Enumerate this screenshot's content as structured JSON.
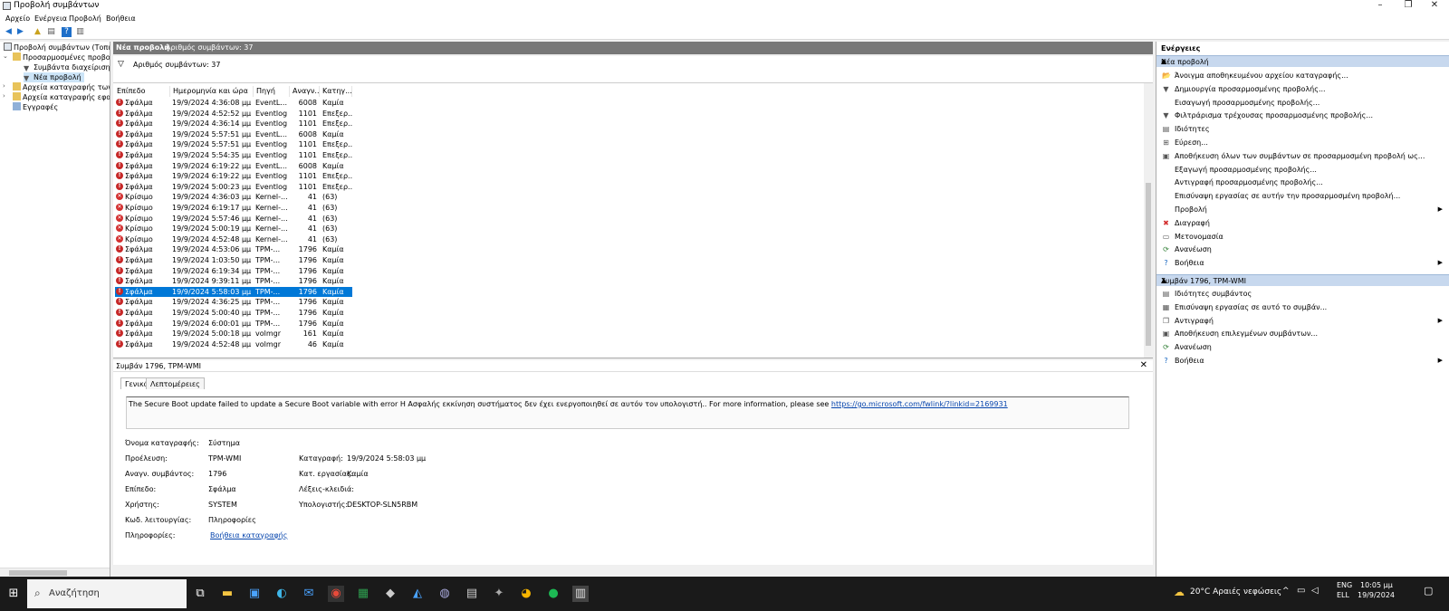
{
  "window": {
    "title": "Προβολή συμβάντων"
  },
  "menu": [
    "Αρχείο",
    "Ενέργεια",
    "Προβολή",
    "Βοήθεια"
  ],
  "tree": {
    "items": [
      {
        "label": "Προβολή συμβάντων (Τοπική)"
      },
      {
        "label": "Προσαρμοσμένες προβολές"
      },
      {
        "label": "Συμβάντα διαχείρισης"
      },
      {
        "label": "Νέα προβολή"
      },
      {
        "label": "Αρχεία καταγραφής των Windows"
      },
      {
        "label": "Αρχεία καταγραφής εφαρμογών"
      },
      {
        "label": "Εγγραφές"
      }
    ]
  },
  "middle": {
    "header_title": "Νέα προβολή",
    "header_count": "Αριθμός συμβάντων: 37",
    "filter_text": "Αριθμός συμβάντων: 37"
  },
  "columns": [
    "Επίπεδο",
    "Ημερομηνία και ώρα",
    "Πηγή",
    "Αναγν...",
    "Κατηγ..."
  ],
  "events": [
    {
      "level": "Σφάλμα",
      "date": "19/9/2024 4:36:08 μμ",
      "source": "EventL...",
      "id": "6008",
      "cat": "Καμία",
      "crit": false
    },
    {
      "level": "Σφάλμα",
      "date": "19/9/2024 4:52:52 μμ",
      "source": "Eventlog",
      "id": "1101",
      "cat": "Επεξερ...",
      "crit": false
    },
    {
      "level": "Σφάλμα",
      "date": "19/9/2024 4:36:14 μμ",
      "source": "Eventlog",
      "id": "1101",
      "cat": "Επεξερ...",
      "crit": false
    },
    {
      "level": "Σφάλμα",
      "date": "19/9/2024 5:57:51 μμ",
      "source": "EventL...",
      "id": "6008",
      "cat": "Καμία",
      "crit": false
    },
    {
      "level": "Σφάλμα",
      "date": "19/9/2024 5:57:51 μμ",
      "source": "Eventlog",
      "id": "1101",
      "cat": "Επεξερ...",
      "crit": false
    },
    {
      "level": "Σφάλμα",
      "date": "19/9/2024 5:54:35 μμ",
      "source": "Eventlog",
      "id": "1101",
      "cat": "Επεξερ...",
      "crit": false
    },
    {
      "level": "Σφάλμα",
      "date": "19/9/2024 6:19:22 μμ",
      "source": "EventL...",
      "id": "6008",
      "cat": "Καμία",
      "crit": false
    },
    {
      "level": "Σφάλμα",
      "date": "19/9/2024 6:19:22 μμ",
      "source": "Eventlog",
      "id": "1101",
      "cat": "Επεξερ...",
      "crit": false
    },
    {
      "level": "Σφάλμα",
      "date": "19/9/2024 5:00:23 μμ",
      "source": "Eventlog",
      "id": "1101",
      "cat": "Επεξερ...",
      "crit": false
    },
    {
      "level": "Κρίσιμο",
      "date": "19/9/2024 4:36:03 μμ",
      "source": "Kernel-...",
      "id": "41",
      "cat": "(63)",
      "crit": true
    },
    {
      "level": "Κρίσιμο",
      "date": "19/9/2024 6:19:17 μμ",
      "source": "Kernel-...",
      "id": "41",
      "cat": "(63)",
      "crit": true
    },
    {
      "level": "Κρίσιμο",
      "date": "19/9/2024 5:57:46 μμ",
      "source": "Kernel-...",
      "id": "41",
      "cat": "(63)",
      "crit": true
    },
    {
      "level": "Κρίσιμο",
      "date": "19/9/2024 5:00:19 μμ",
      "source": "Kernel-...",
      "id": "41",
      "cat": "(63)",
      "crit": true
    },
    {
      "level": "Κρίσιμο",
      "date": "19/9/2024 4:52:48 μμ",
      "source": "Kernel-...",
      "id": "41",
      "cat": "(63)",
      "crit": true
    },
    {
      "level": "Σφάλμα",
      "date": "19/9/2024 4:53:06 μμ",
      "source": "TPM-...",
      "id": "1796",
      "cat": "Καμία",
      "crit": false
    },
    {
      "level": "Σφάλμα",
      "date": "19/9/2024 1:03:50 μμ",
      "source": "TPM-...",
      "id": "1796",
      "cat": "Καμία",
      "crit": false
    },
    {
      "level": "Σφάλμα",
      "date": "19/9/2024 6:19:34 μμ",
      "source": "TPM-...",
      "id": "1796",
      "cat": "Καμία",
      "crit": false
    },
    {
      "level": "Σφάλμα",
      "date": "19/9/2024 9:39:11 μμ",
      "source": "TPM-...",
      "id": "1796",
      "cat": "Καμία",
      "crit": false
    },
    {
      "level": "Σφάλμα",
      "date": "19/9/2024 5:58:03 μμ",
      "source": "TPM-...",
      "id": "1796",
      "cat": "Καμία",
      "crit": false,
      "selected": true
    },
    {
      "level": "Σφάλμα",
      "date": "19/9/2024 4:36:25 μμ",
      "source": "TPM-...",
      "id": "1796",
      "cat": "Καμία",
      "crit": false
    },
    {
      "level": "Σφάλμα",
      "date": "19/9/2024 5:00:40 μμ",
      "source": "TPM-...",
      "id": "1796",
      "cat": "Καμία",
      "crit": false
    },
    {
      "level": "Σφάλμα",
      "date": "19/9/2024 6:00:01 μμ",
      "source": "TPM-...",
      "id": "1796",
      "cat": "Καμία",
      "crit": false
    },
    {
      "level": "Σφάλμα",
      "date": "19/9/2024 5:00:18 μμ",
      "source": "volmgr",
      "id": "161",
      "cat": "Καμία",
      "crit": false
    },
    {
      "level": "Σφάλμα",
      "date": "19/9/2024 4:52:48 μμ",
      "source": "volmgr",
      "id": "46",
      "cat": "Καμία",
      "crit": false
    }
  ],
  "detail": {
    "title": "Συμβάν 1796, TPM-WMI",
    "tabs": [
      "Γενικά",
      "Λεπτομέρειες"
    ],
    "description": "The Secure Boot update failed to update a Secure Boot variable with error Η Ασφαλής εκκίνηση συστήματος δεν έχει ενεργοποιηθεί σε αυτόν τον υπολογιστή.. For more information, please see ",
    "description_link": "https://go.microsoft.com/fwlink/?linkid=2169931",
    "props": {
      "log_name_label": "Όνομα καταγραφής:",
      "log_name": "Σύστημα",
      "source_label": "Προέλευση:",
      "source": "TPM-WMI",
      "logged_label": "Καταγραφή:",
      "logged": "19/9/2024 5:58:03 μμ",
      "event_id_label": "Αναγν. συμβάντος:",
      "event_id": "1796",
      "task_label": "Κατ. εργασίας:",
      "task": "Καμία",
      "level_label": "Επίπεδο:",
      "level": "Σφάλμα",
      "keywords_label": "Λέξεις-κλειδιά:",
      "user_label": "Χρήστης:",
      "user": "SYSTEM",
      "computer_label": "Υπολογιστής:",
      "computer": "DESKTOP-SLN5RBM",
      "opcode_label": "Κωδ. λειτουργίας:",
      "opcode": "Πληροφορίες",
      "info_label": "Πληροφορίες:",
      "info_link": "Βοήθεια καταγραφής"
    }
  },
  "actions": {
    "title": "Ενέργειες",
    "section1": "Νέα προβολή",
    "items1": [
      {
        "label": "Άνοιγμα αποθηκευμένου αρχείου καταγραφής...",
        "icon": "folder-icon",
        "glyph": "📂"
      },
      {
        "label": "Δημιουργία προσαρμοσμένης προβολής...",
        "icon": "filter-icon",
        "glyph": "▼"
      },
      {
        "label": "Εισαγωγή προσαρμοσμένης προβολής...",
        "icon": "",
        "glyph": ""
      },
      {
        "label": "Φιλτράρισμα τρέχουσας προσαρμοσμένης προβολής...",
        "icon": "filter-icon",
        "glyph": "▼"
      },
      {
        "label": "Ιδιότητες",
        "icon": "properties-icon",
        "glyph": "▤"
      },
      {
        "label": "Εύρεση...",
        "icon": "find-icon",
        "glyph": "⊞"
      },
      {
        "label": "Αποθήκευση όλων των συμβάντων σε προσαρμοσμένη προβολή ως...",
        "icon": "save-icon",
        "glyph": "▣"
      },
      {
        "label": "Εξαγωγή προσαρμοσμένης προβολής...",
        "icon": "",
        "glyph": ""
      },
      {
        "label": "Αντιγραφή προσαρμοσμένης προβολής...",
        "icon": "",
        "glyph": ""
      },
      {
        "label": "Επισύναψη εργασίας σε αυτήν την προσαρμοσμένη προβολή...",
        "icon": "",
        "glyph": ""
      },
      {
        "label": "Προβολή",
        "icon": "",
        "glyph": "",
        "arrow": true
      },
      {
        "label": "Διαγραφή",
        "icon": "delete-icon",
        "glyph": "✖",
        "color": "#d32f2f"
      },
      {
        "label": "Μετονομασία",
        "icon": "rename-icon",
        "glyph": "▭"
      },
      {
        "label": "Ανανέωση",
        "icon": "refresh-icon",
        "glyph": "⟳",
        "color": "#2e7d32"
      },
      {
        "label": "Βοήθεια",
        "icon": "help-icon",
        "glyph": "?",
        "color": "#1565c0",
        "arrow": true
      }
    ],
    "section2": "Συμβάν 1796, TPM-WMI",
    "items2": [
      {
        "label": "Ιδιότητες συμβάντος",
        "icon": "properties-icon",
        "glyph": "▤"
      },
      {
        "label": "Επισύναψη εργασίας σε αυτό το συμβάν...",
        "icon": "task-icon",
        "glyph": "▦"
      },
      {
        "label": "Αντιγραφή",
        "icon": "copy-icon",
        "glyph": "❐",
        "arrow": true
      },
      {
        "label": "Αποθήκευση επιλεγμένων συμβάντων...",
        "icon": "save-icon",
        "glyph": "▣"
      },
      {
        "label": "Ανανέωση",
        "icon": "refresh-icon",
        "glyph": "⟳",
        "color": "#2e7d32"
      },
      {
        "label": "Βοήθεια",
        "icon": "help-icon",
        "glyph": "?",
        "color": "#1565c0",
        "arrow": true
      }
    ]
  },
  "taskbar": {
    "search_text": "Αναζήτηση",
    "weather": "20°C Αραιές νεφώσεις",
    "lang1": "ENG",
    "lang2": "ELL",
    "time": "10:05 μμ",
    "date": "19/9/2024"
  }
}
